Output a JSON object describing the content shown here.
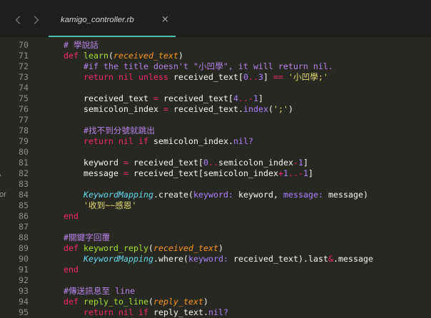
{
  "window": {
    "nav": {
      "back_icon": "chevron-left-icon",
      "forward_icon": "chevron-right-icon"
    },
    "tab": {
      "label": "kamigo_controller.rb",
      "close_icon": "close-icon",
      "close_glyph": "×"
    }
  },
  "sidebar_fragments": [
    ",",
    "or"
  ],
  "theme": {
    "bg": "#272822",
    "topbar": "#1e1f1c",
    "accent": "#4cbfae",
    "text": "#f8f8f2",
    "gutter": "#8f908a",
    "keyword": "#f92672",
    "function": "#a6e22e",
    "parameter": "#fd971f",
    "comment": "#b883ea",
    "number": "#ae81ff",
    "operator": "#f92672",
    "string": "#e6db74",
    "constant": "#66d9ef",
    "symbol": "#ae81ff",
    "method": "#ae81ff",
    "tab_text": "#d6d6d6",
    "nav_icon": "#6d6d6d",
    "close_icon": "#a8a8a8",
    "fragment": "#9a9a9a"
  },
  "editor": {
    "language": "ruby",
    "lines": [
      {
        "n": "70",
        "tokens": [
          {
            "t": "    ",
            "c": "plain"
          },
          {
            "t": "# 學說話",
            "c": "comment"
          }
        ]
      },
      {
        "n": "71",
        "tokens": [
          {
            "t": "    ",
            "c": "plain"
          },
          {
            "t": "def",
            "c": "keyword"
          },
          {
            "t": " ",
            "c": "plain"
          },
          {
            "t": "learn",
            "c": "function"
          },
          {
            "t": "(",
            "c": "plain"
          },
          {
            "t": "received_text",
            "c": "parameter"
          },
          {
            "t": ")",
            "c": "plain"
          }
        ]
      },
      {
        "n": "72",
        "tokens": [
          {
            "t": "        ",
            "c": "plain"
          },
          {
            "t": "#if the title doesn't \"小凹學\", it will return nil.",
            "c": "comment"
          }
        ]
      },
      {
        "n": "73",
        "tokens": [
          {
            "t": "        ",
            "c": "plain"
          },
          {
            "t": "return nil unless",
            "c": "keyword"
          },
          {
            "t": " received_text[",
            "c": "plain"
          },
          {
            "t": "0",
            "c": "number"
          },
          {
            "t": "..",
            "c": "operator"
          },
          {
            "t": "3",
            "c": "number"
          },
          {
            "t": "] ",
            "c": "plain"
          },
          {
            "t": "==",
            "c": "operator"
          },
          {
            "t": " ",
            "c": "plain"
          },
          {
            "t": "'小凹學;'",
            "c": "string"
          }
        ]
      },
      {
        "n": "74",
        "tokens": []
      },
      {
        "n": "75",
        "tokens": [
          {
            "t": "        received_text ",
            "c": "plain"
          },
          {
            "t": "=",
            "c": "operator"
          },
          {
            "t": " received_text[",
            "c": "plain"
          },
          {
            "t": "4",
            "c": "number"
          },
          {
            "t": "..-",
            "c": "operator"
          },
          {
            "t": "1",
            "c": "number"
          },
          {
            "t": "]",
            "c": "plain"
          }
        ]
      },
      {
        "n": "76",
        "tokens": [
          {
            "t": "        semicolon_index ",
            "c": "plain"
          },
          {
            "t": "=",
            "c": "operator"
          },
          {
            "t": " received_text.",
            "c": "plain"
          },
          {
            "t": "index",
            "c": "method"
          },
          {
            "t": "(",
            "c": "plain"
          },
          {
            "t": "';'",
            "c": "string"
          },
          {
            "t": ")",
            "c": "plain"
          }
        ]
      },
      {
        "n": "77",
        "tokens": []
      },
      {
        "n": "78",
        "tokens": [
          {
            "t": "        ",
            "c": "plain"
          },
          {
            "t": "#找不到分號就跳出",
            "c": "comment"
          }
        ]
      },
      {
        "n": "79",
        "tokens": [
          {
            "t": "        ",
            "c": "plain"
          },
          {
            "t": "return nil if",
            "c": "keyword"
          },
          {
            "t": " semicolon_index.",
            "c": "plain"
          },
          {
            "t": "nil?",
            "c": "method"
          }
        ]
      },
      {
        "n": "80",
        "tokens": []
      },
      {
        "n": "81",
        "tokens": [
          {
            "t": "        keyword ",
            "c": "plain"
          },
          {
            "t": "=",
            "c": "operator"
          },
          {
            "t": " received_text[",
            "c": "plain"
          },
          {
            "t": "0",
            "c": "number"
          },
          {
            "t": "..",
            "c": "operator"
          },
          {
            "t": "semicolon_index",
            "c": "plain"
          },
          {
            "t": "-",
            "c": "operator"
          },
          {
            "t": "1",
            "c": "number"
          },
          {
            "t": "]",
            "c": "plain"
          }
        ]
      },
      {
        "n": "82",
        "tokens": [
          {
            "t": "        message ",
            "c": "plain"
          },
          {
            "t": "=",
            "c": "operator"
          },
          {
            "t": " received_text[semicolon_index",
            "c": "plain"
          },
          {
            "t": "+",
            "c": "operator"
          },
          {
            "t": "1",
            "c": "number"
          },
          {
            "t": "..-",
            "c": "operator"
          },
          {
            "t": "1",
            "c": "number"
          },
          {
            "t": "]",
            "c": "plain"
          }
        ]
      },
      {
        "n": "83",
        "tokens": []
      },
      {
        "n": "84",
        "tokens": [
          {
            "t": "        ",
            "c": "plain"
          },
          {
            "t": "KeywordMapping",
            "c": "constant"
          },
          {
            "t": ".create(",
            "c": "plain"
          },
          {
            "t": "keyword:",
            "c": "symbol"
          },
          {
            "t": " keyword, ",
            "c": "plain"
          },
          {
            "t": "message:",
            "c": "symbol"
          },
          {
            "t": " message)",
            "c": "plain"
          }
        ]
      },
      {
        "n": "85",
        "tokens": [
          {
            "t": "        ",
            "c": "plain"
          },
          {
            "t": "'收到~~感恩'",
            "c": "string"
          }
        ]
      },
      {
        "n": "86",
        "tokens": [
          {
            "t": "    ",
            "c": "plain"
          },
          {
            "t": "end",
            "c": "keyword"
          }
        ]
      },
      {
        "n": "87",
        "tokens": []
      },
      {
        "n": "88",
        "tokens": [
          {
            "t": "    ",
            "c": "plain"
          },
          {
            "t": "#關鍵字回覆",
            "c": "comment"
          }
        ]
      },
      {
        "n": "89",
        "tokens": [
          {
            "t": "    ",
            "c": "plain"
          },
          {
            "t": "def",
            "c": "keyword"
          },
          {
            "t": " ",
            "c": "plain"
          },
          {
            "t": "keyword_reply",
            "c": "function"
          },
          {
            "t": "(",
            "c": "plain"
          },
          {
            "t": "received_text",
            "c": "parameter"
          },
          {
            "t": ")",
            "c": "plain"
          }
        ]
      },
      {
        "n": "90",
        "tokens": [
          {
            "t": "        ",
            "c": "plain"
          },
          {
            "t": "KeywordMapping",
            "c": "constant"
          },
          {
            "t": ".where(",
            "c": "plain"
          },
          {
            "t": "keyword:",
            "c": "symbol"
          },
          {
            "t": " received_text).last",
            "c": "plain"
          },
          {
            "t": "&",
            "c": "operator"
          },
          {
            "t": ".message",
            "c": "plain"
          }
        ]
      },
      {
        "n": "91",
        "tokens": [
          {
            "t": "    ",
            "c": "plain"
          },
          {
            "t": "end",
            "c": "keyword"
          }
        ]
      },
      {
        "n": "92",
        "tokens": []
      },
      {
        "n": "93",
        "tokens": [
          {
            "t": "    ",
            "c": "plain"
          },
          {
            "t": "#傳送訊息至 line",
            "c": "comment"
          }
        ]
      },
      {
        "n": "94",
        "tokens": [
          {
            "t": "    ",
            "c": "plain"
          },
          {
            "t": "def",
            "c": "keyword"
          },
          {
            "t": " ",
            "c": "plain"
          },
          {
            "t": "reply_to_line",
            "c": "function"
          },
          {
            "t": "(",
            "c": "plain"
          },
          {
            "t": "reply_text",
            "c": "parameter"
          },
          {
            "t": ")",
            "c": "plain"
          }
        ]
      },
      {
        "n": "95",
        "tokens": [
          {
            "t": "        ",
            "c": "plain"
          },
          {
            "t": "return nil if",
            "c": "keyword"
          },
          {
            "t": " reply_text.",
            "c": "plain"
          },
          {
            "t": "nil?",
            "c": "method"
          }
        ]
      }
    ]
  }
}
